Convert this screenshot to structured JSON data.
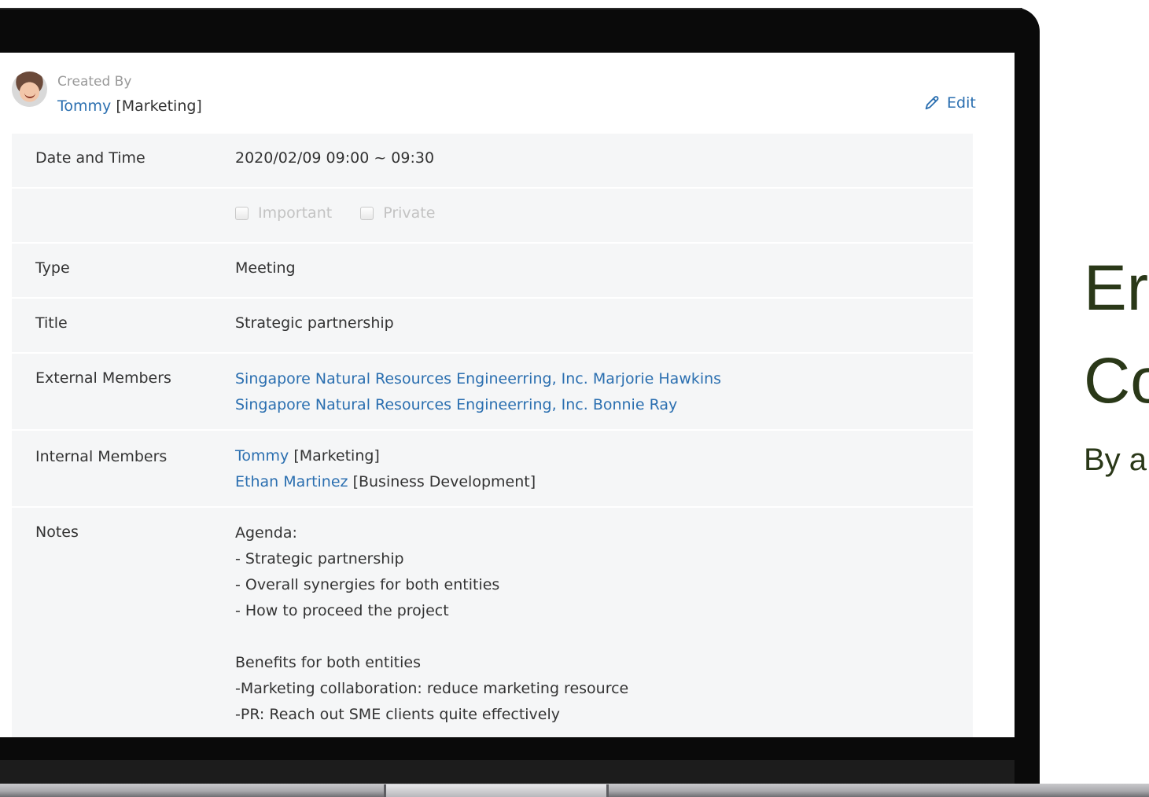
{
  "header": {
    "created_by_label": "Created By",
    "creator_name": "Tommy",
    "creator_dept": "[Marketing]",
    "edit_label": "Edit"
  },
  "details": {
    "date_time": {
      "label": "Date and Time",
      "value": "2020/02/09 09:00 ~ 09:30"
    },
    "flags": {
      "important": "Important",
      "private": "Private",
      "important_checked": false,
      "private_checked": false
    },
    "type": {
      "label": "Type",
      "value": "Meeting"
    },
    "title": {
      "label": "Title",
      "value": "Strategic partnership"
    },
    "external_members": {
      "label": "External Members",
      "items": [
        "Singapore Natural Resources Engineerring, Inc. Marjorie Hawkins",
        "Singapore Natural Resources Engineerring, Inc. Bonnie Ray"
      ]
    },
    "internal_members": {
      "label": "Internal Members",
      "items": [
        {
          "name": "Tommy",
          "dept": "[Marketing]"
        },
        {
          "name": "Ethan Martinez",
          "dept": "[Business Development]"
        }
      ]
    },
    "notes": {
      "label": "Notes",
      "lines": [
        "Agenda:",
        "- Strategic partnership",
        "- Overall synergies for both entities",
        "- How to proceed the project",
        "",
        "Benefits for both entities",
        "-Marketing collaboration: reduce marketing resource",
        "-PR: Reach out SME clients quite effectively"
      ]
    }
  },
  "promo": {
    "line1": "Er",
    "line2": "Co",
    "line3": "By a"
  },
  "colors": {
    "link": "#2b6fb0",
    "row_bg": "#f5f6f7",
    "promo_text": "#2a3818"
  }
}
